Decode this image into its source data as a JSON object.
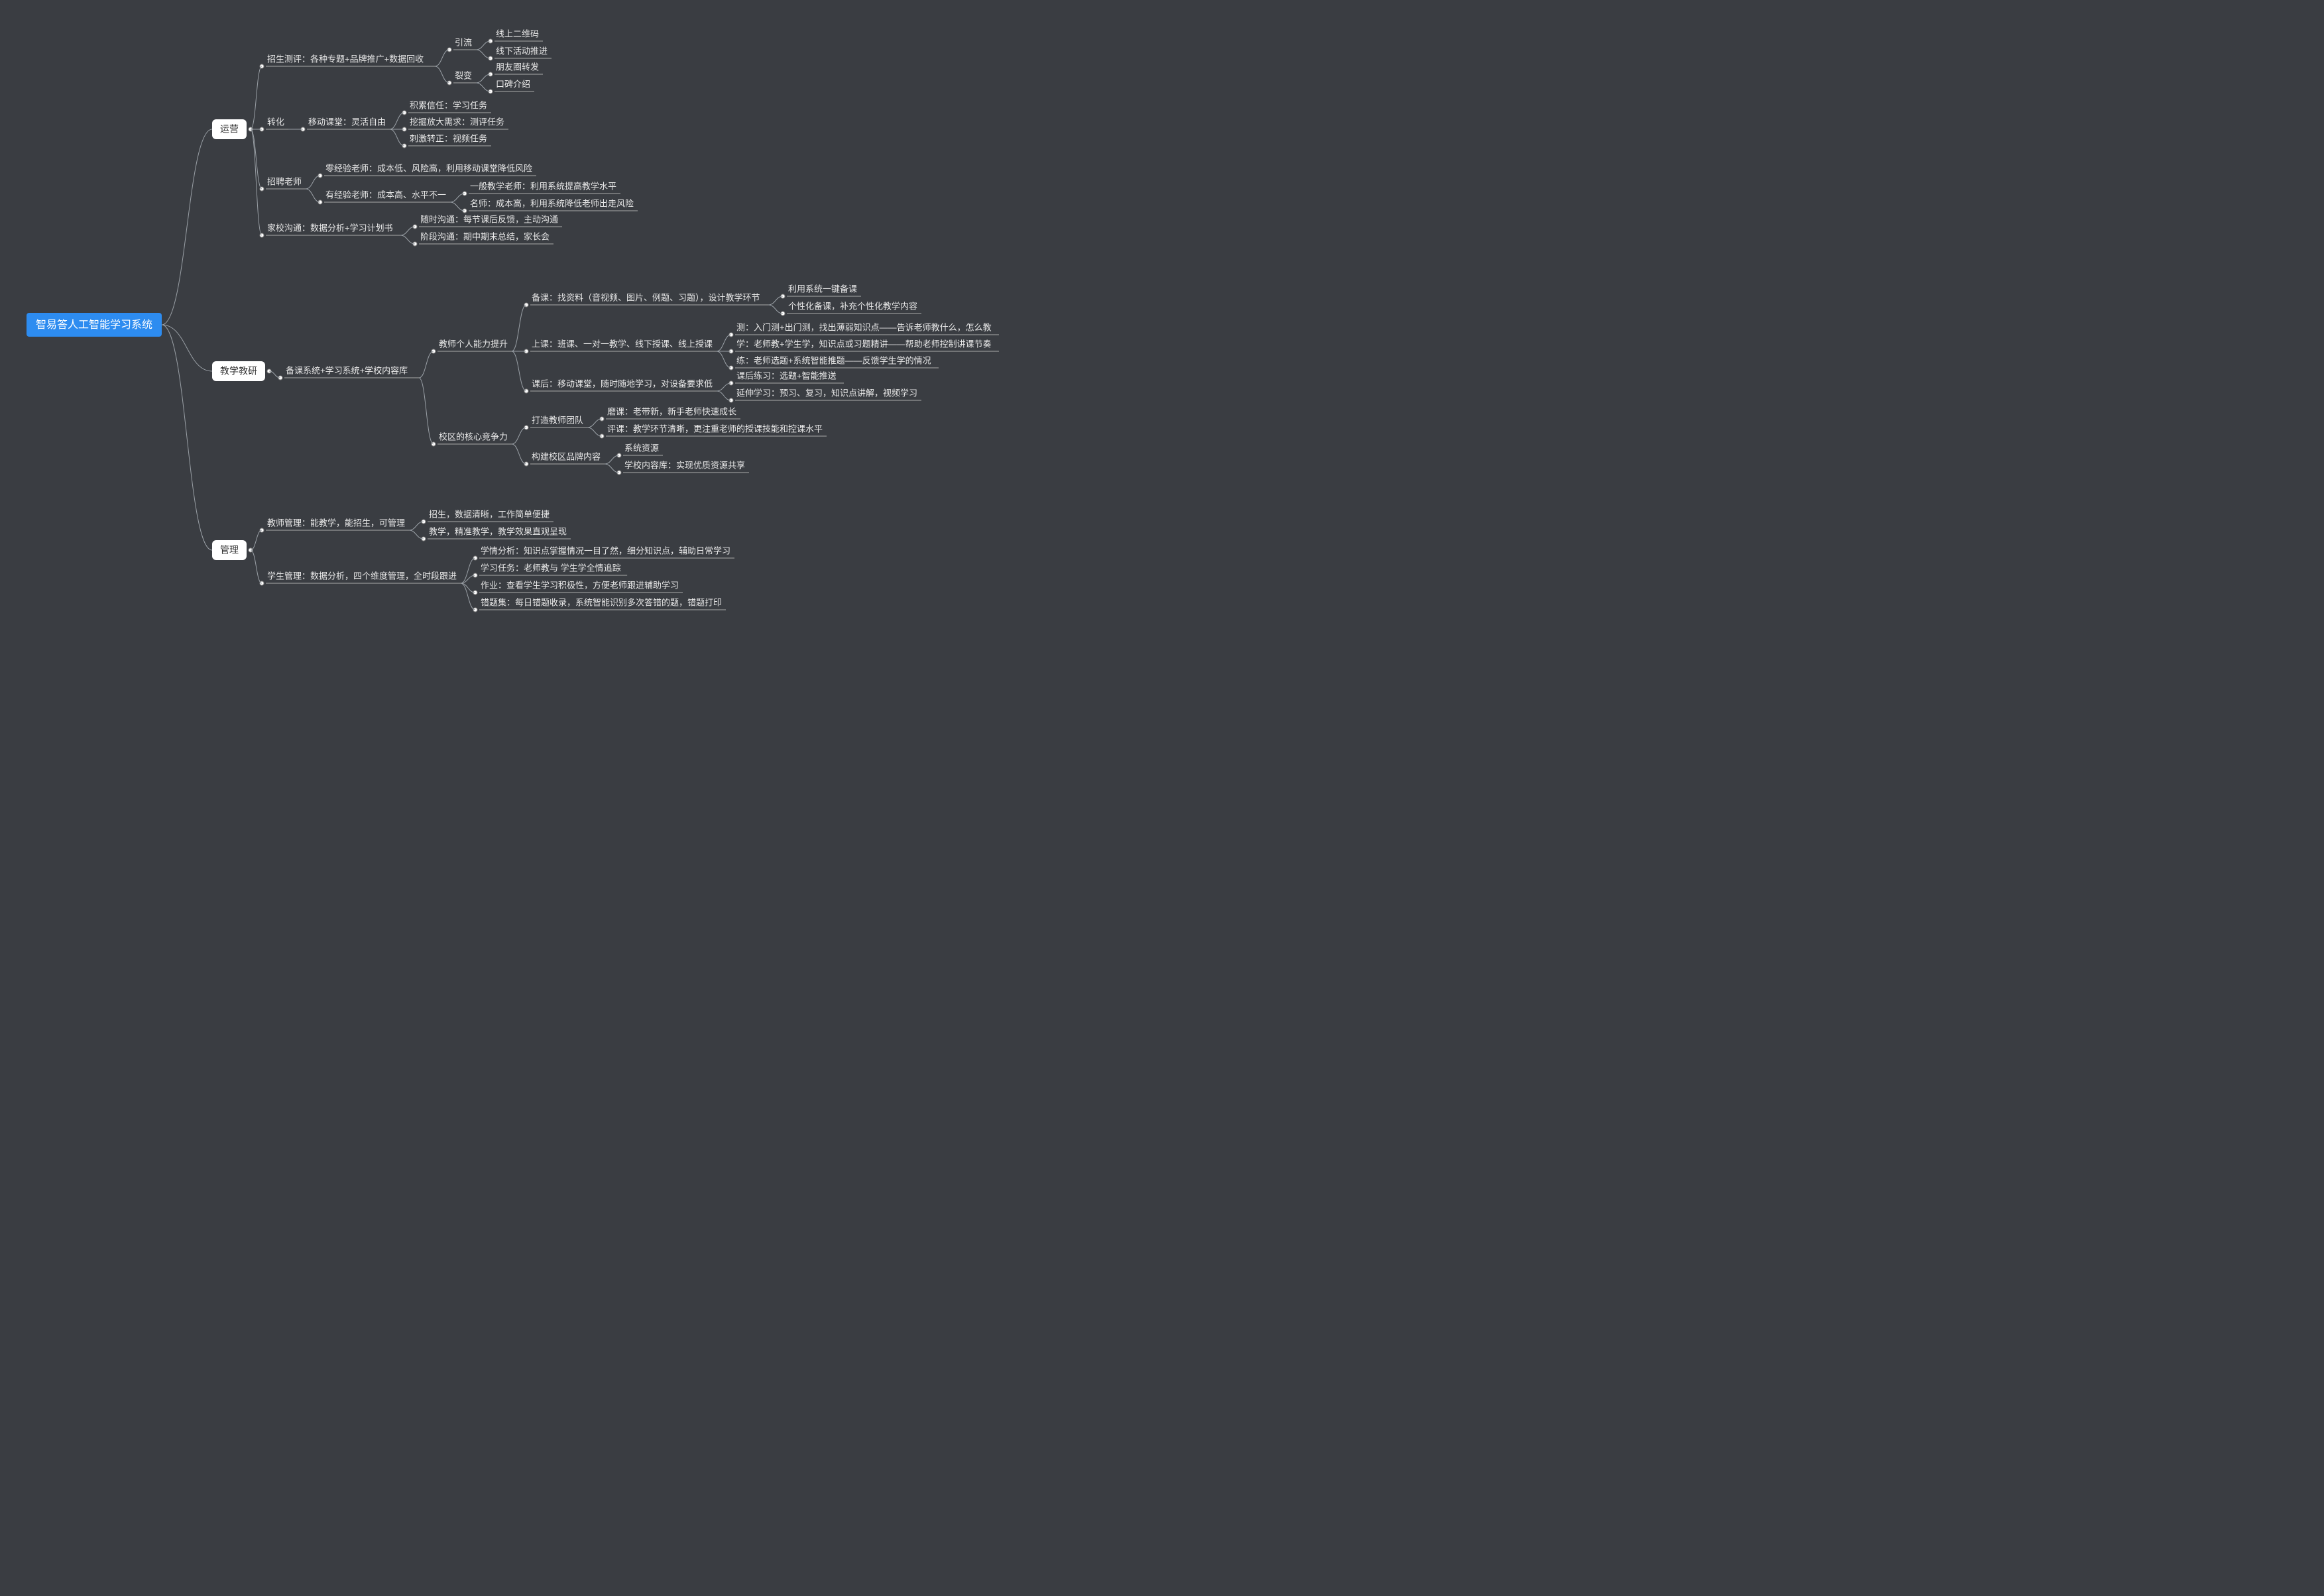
{
  "root": {
    "label": "智易答人工智能学习系统"
  },
  "branches": [
    {
      "key": "ops",
      "label": "运营",
      "children": [
        {
          "label": "招生测评：各种专题+品牌推广+数据回收",
          "children": [
            {
              "label": "引流",
              "children": [
                {
                  "label": "线上二维码"
                },
                {
                  "label": "线下活动推进"
                }
              ]
            },
            {
              "label": "裂变",
              "children": [
                {
                  "label": "朋友圈转发"
                },
                {
                  "label": "口碑介绍"
                }
              ]
            }
          ]
        },
        {
          "label": "转化",
          "children": [
            {
              "label": "移动课堂：灵活自由",
              "children": [
                {
                  "label": "积累信任：学习任务"
                },
                {
                  "label": "挖掘放大需求：测评任务"
                },
                {
                  "label": "刺激转正：视频任务"
                }
              ]
            }
          ]
        },
        {
          "label": "招聘老师",
          "children": [
            {
              "label": "零经验老师：成本低、风险高，利用移动课堂降低风险"
            },
            {
              "label": "有经验老师：成本高、水平不一",
              "children": [
                {
                  "label": "一般教学老师：利用系统提高教学水平"
                },
                {
                  "label": "名师：成本高，利用系统降低老师出走风险"
                }
              ]
            }
          ]
        },
        {
          "label": "家校沟通：数据分析+学习计划书",
          "children": [
            {
              "label": "随时沟通：每节课后反馈，主动沟通"
            },
            {
              "label": "阶段沟通：期中期末总结，家长会"
            }
          ]
        }
      ]
    },
    {
      "key": "teach",
      "label": "教学教研",
      "children": [
        {
          "label": "备课系统+学习系统+学校内容库",
          "children": [
            {
              "label": "教师个人能力提升",
              "children": [
                {
                  "label": "备课：找资料（音视频、图片、例题、习题），设计教学环节",
                  "children": [
                    {
                      "label": "利用系统一键备课"
                    },
                    {
                      "label": "个性化备课，补充个性化教学内容"
                    }
                  ]
                },
                {
                  "label": "上课：班课、一对一教学、线下授课、线上授课",
                  "children": [
                    {
                      "label": "测：入门测+出门测，找出薄弱知识点——告诉老师教什么，怎么教"
                    },
                    {
                      "label": "学：老师教+学生学，知识点或习题精讲——帮助老师控制讲课节奏"
                    },
                    {
                      "label": "练：老师选题+系统智能推题——反馈学生学的情况"
                    }
                  ]
                },
                {
                  "label": "课后：移动课堂，随时随地学习，对设备要求低",
                  "children": [
                    {
                      "label": "课后练习：选题+智能推送"
                    },
                    {
                      "label": "延伸学习：预习、复习，知识点讲解，视频学习"
                    }
                  ]
                }
              ]
            },
            {
              "label": "校区的核心竞争力",
              "children": [
                {
                  "label": "打造教师团队",
                  "children": [
                    {
                      "label": "磨课：老带新，新手老师快速成长"
                    },
                    {
                      "label": "评课：教学环节清晰，更注重老师的授课技能和控课水平"
                    }
                  ]
                },
                {
                  "label": "构建校区品牌内容",
                  "children": [
                    {
                      "label": "系统资源"
                    },
                    {
                      "label": "学校内容库：实现优质资源共享"
                    }
                  ]
                }
              ]
            }
          ]
        }
      ]
    },
    {
      "key": "mgmt",
      "label": "管理",
      "children": [
        {
          "label": "教师管理：能教学，能招生，可管理",
          "children": [
            {
              "label": "招生，数据清晰，工作简单便捷"
            },
            {
              "label": "教学，精准教学，教学效果直观呈现"
            }
          ]
        },
        {
          "label": "学生管理：数据分析，四个维度管理，全时段跟进",
          "children": [
            {
              "label": "学情分析：知识点掌握情况一目了然，细分知识点，辅助日常学习"
            },
            {
              "label": "学习任务：老师教与 学生学全情追踪"
            },
            {
              "label": "作业：查看学生学习积极性，方便老师跟进辅助学习"
            },
            {
              "label": "错题集：每日错题收录，系统智能识别多次答错的题，错题打印"
            }
          ]
        }
      ]
    }
  ]
}
